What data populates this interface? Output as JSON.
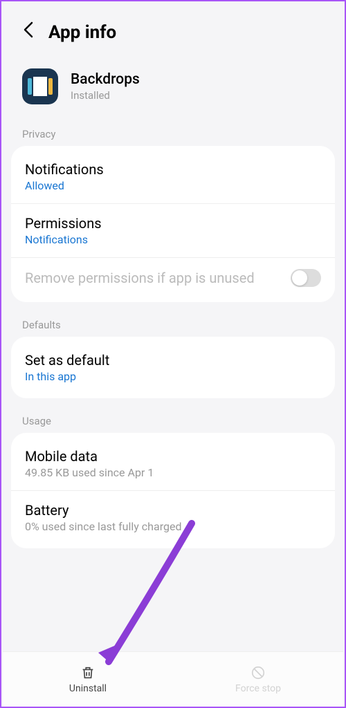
{
  "header": {
    "title": "App info"
  },
  "app": {
    "name": "Backdrops",
    "status": "Installed"
  },
  "sections": {
    "privacy": {
      "label": "Privacy",
      "notifications": {
        "title": "Notifications",
        "value": "Allowed"
      },
      "permissions": {
        "title": "Permissions",
        "value": "Notifications"
      },
      "removePerms": {
        "title": "Remove permissions if app is unused",
        "enabled": false
      }
    },
    "defaults": {
      "label": "Defaults",
      "setDefault": {
        "title": "Set as default",
        "value": "In this app"
      }
    },
    "usage": {
      "label": "Usage",
      "mobileData": {
        "title": "Mobile data",
        "value": "49.85 KB used since Apr 1"
      },
      "battery": {
        "title": "Battery",
        "value": "0% used since last fully charged"
      }
    }
  },
  "bottomBar": {
    "uninstall": "Uninstall",
    "forceStop": "Force stop"
  }
}
